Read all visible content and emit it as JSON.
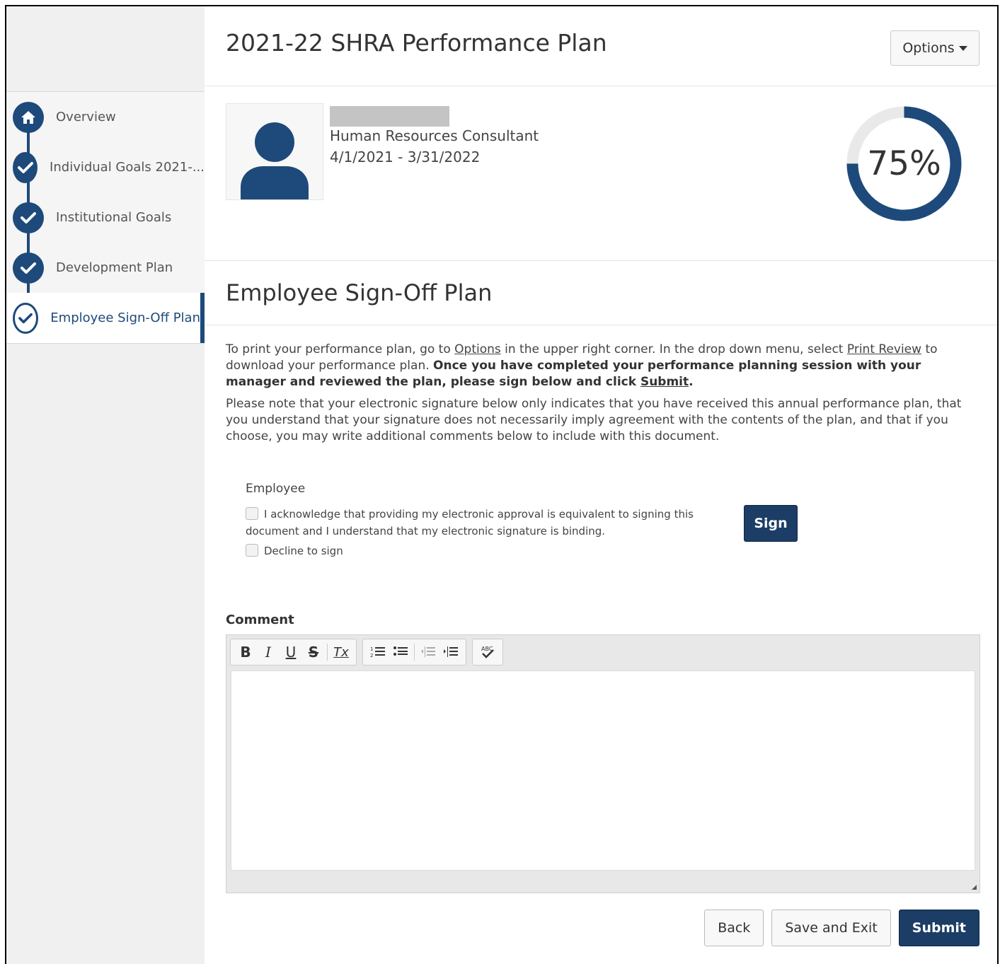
{
  "sidebar": {
    "items": [
      {
        "label": "Overview",
        "icon": "home-icon",
        "state": "complete"
      },
      {
        "label": "Individual Goals 2021-...",
        "icon": "checkmark-icon",
        "state": "complete"
      },
      {
        "label": "Institutional Goals",
        "icon": "checkmark-icon",
        "state": "complete"
      },
      {
        "label": "Development Plan",
        "icon": "checkmark-icon",
        "state": "complete"
      },
      {
        "label": "Employee Sign-Off Plan",
        "icon": "checkmark-icon",
        "state": "active"
      }
    ]
  },
  "header": {
    "title": "2021-22 SHRA Performance Plan",
    "options_label": "Options"
  },
  "profile": {
    "job_title": "Human Resources Consultant",
    "dates": "4/1/2021 - 3/31/2022",
    "progress_percent": 75,
    "progress_label": "75%"
  },
  "section": {
    "title": "Employee Sign-Off Plan",
    "para1_a": "To print your performance plan, go to ",
    "para1_options": "Options",
    "para1_b": " in the upper right corner. In the drop down menu, select ",
    "para1_print": "Print Review",
    "para1_c": " to download your performance plan. ",
    "para1_bold": "Once you have completed your performance planning session with your manager and reviewed the plan, please sign below and click ",
    "para1_submit": "Submit",
    "para1_end": ".",
    "para2": "Please note that your electronic signature below only indicates that you have received this annual performance plan, that you understand that your signature does not necessarily imply agreement with the contents of the plan, and that if you choose, you may write additional comments below to include with this document."
  },
  "signoff": {
    "employee_label": "Employee",
    "acknowledge_text": "I acknowledge that providing my electronic approval is equivalent to signing this document and I understand that my electronic signature is binding.",
    "decline_text": "Decline to sign",
    "sign_label": "Sign"
  },
  "comment": {
    "label": "Comment",
    "toolbar": {
      "bold": "B",
      "italic": "I",
      "underline": "U",
      "strike": "S",
      "clear": "Tx",
      "numbered": "numbered-list-icon",
      "bulleted": "bulleted-list-icon",
      "outdent": "outdent-icon",
      "indent": "indent-icon",
      "spellcheck": "spellcheck-icon"
    }
  },
  "footer": {
    "back_label": "Back",
    "save_exit_label": "Save and Exit",
    "submit_label": "Submit"
  },
  "colors": {
    "accent": "#1d4a7a",
    "primary_button": "#1b3d66",
    "progress_track": "#e9e9e9"
  }
}
